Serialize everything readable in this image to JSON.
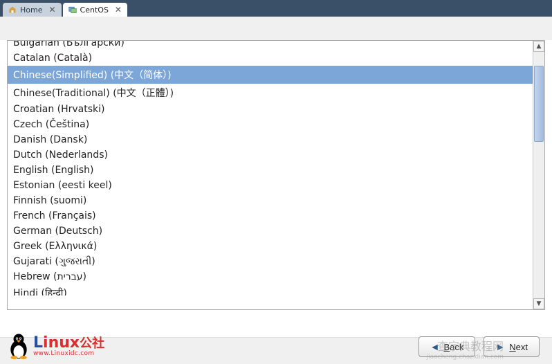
{
  "tabs": [
    {
      "label": "Home",
      "active": false
    },
    {
      "label": "CentOS",
      "active": true
    }
  ],
  "languages": [
    {
      "label": "Bulgarian (Български)",
      "selected": false,
      "partial": "top"
    },
    {
      "label": "Catalan (Català)",
      "selected": false
    },
    {
      "label": "Chinese(Simplified) (中文（简体）)",
      "selected": true
    },
    {
      "label": "Chinese(Traditional) (中文（正體）)",
      "selected": false
    },
    {
      "label": "Croatian (Hrvatski)",
      "selected": false
    },
    {
      "label": "Czech (Čeština)",
      "selected": false
    },
    {
      "label": "Danish (Dansk)",
      "selected": false
    },
    {
      "label": "Dutch (Nederlands)",
      "selected": false
    },
    {
      "label": "English (English)",
      "selected": false
    },
    {
      "label": "Estonian (eesti keel)",
      "selected": false
    },
    {
      "label": "Finnish (suomi)",
      "selected": false
    },
    {
      "label": "French (Français)",
      "selected": false
    },
    {
      "label": "German (Deutsch)",
      "selected": false
    },
    {
      "label": "Greek (Ελληνικά)",
      "selected": false
    },
    {
      "label": "Gujarati (ગુજરાતી)",
      "selected": false
    },
    {
      "label": "Hebrew (עברית)",
      "selected": false
    },
    {
      "label": "Hindi (हिन्दी)",
      "selected": false,
      "partial": "bottom"
    }
  ],
  "buttons": {
    "back": "Back",
    "next": "Next"
  },
  "watermarks": {
    "logo_main_colored": "L",
    "logo_main_rest": "inux",
    "logo_main_suffix": "公社",
    "logo_url": "www.Linuxidc.com",
    "right_text": "查字典教程网",
    "right_sub": "jiaocheng.chazidian.com"
  }
}
